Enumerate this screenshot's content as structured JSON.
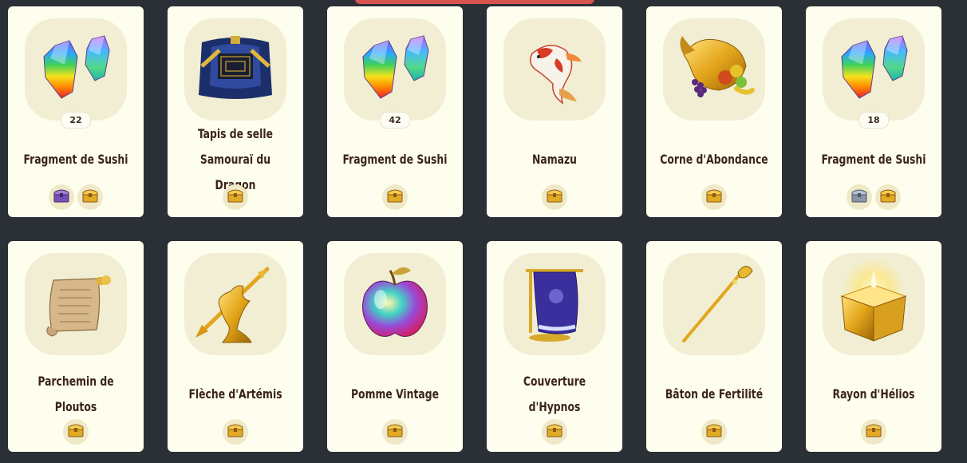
{
  "colors": {
    "background": "#2b2f36",
    "card": "#fefeee",
    "slot": "#f1eed3",
    "title": "#3b2418",
    "banner": "#d9534f"
  },
  "items": [
    {
      "name": "Fragment de Sushi",
      "quantity": "22",
      "icon": "rainbow-crystal-icon",
      "sources": [
        "purple-chest-icon",
        "golden-chest-icon"
      ]
    },
    {
      "name": "Tapis de selle Samouraï du Dragon",
      "quantity": "",
      "icon": "saddle-blanket-icon",
      "sources": [
        "golden-chest-icon"
      ]
    },
    {
      "name": "Fragment de Sushi",
      "quantity": "42",
      "icon": "rainbow-crystal-icon",
      "sources": [
        "golden-chest-icon"
      ]
    },
    {
      "name": "Namazu",
      "quantity": "",
      "icon": "koi-fish-icon",
      "sources": [
        "golden-chest-icon"
      ]
    },
    {
      "name": "Corne d'Abondance",
      "quantity": "",
      "icon": "cornucopia-icon",
      "sources": [
        "golden-chest-icon"
      ]
    },
    {
      "name": "Fragment de Sushi",
      "quantity": "18",
      "icon": "rainbow-crystal-icon",
      "sources": [
        "silver-chest-icon",
        "golden-chest-icon"
      ]
    },
    {
      "name": "Parchemin de Ploutos",
      "quantity": "",
      "icon": "scroll-icon",
      "sources": [
        "golden-chest-icon"
      ]
    },
    {
      "name": "Flèche d'Artémis",
      "quantity": "",
      "icon": "golden-arrow-icon",
      "sources": [
        "golden-chest-icon"
      ]
    },
    {
      "name": "Pomme Vintage",
      "quantity": "",
      "icon": "rainbow-apple-icon",
      "sources": [
        "golden-chest-icon"
      ]
    },
    {
      "name": "Couverture d'Hypnos",
      "quantity": "",
      "icon": "blanket-stand-icon",
      "sources": [
        "golden-chest-icon"
      ]
    },
    {
      "name": "Bâton de Fertilité",
      "quantity": "",
      "icon": "golden-staff-icon",
      "sources": [
        "golden-chest-icon"
      ]
    },
    {
      "name": "Rayon d'Hélios",
      "quantity": "",
      "icon": "glowing-pedestal-icon",
      "sources": [
        "golden-chest-icon"
      ]
    }
  ]
}
